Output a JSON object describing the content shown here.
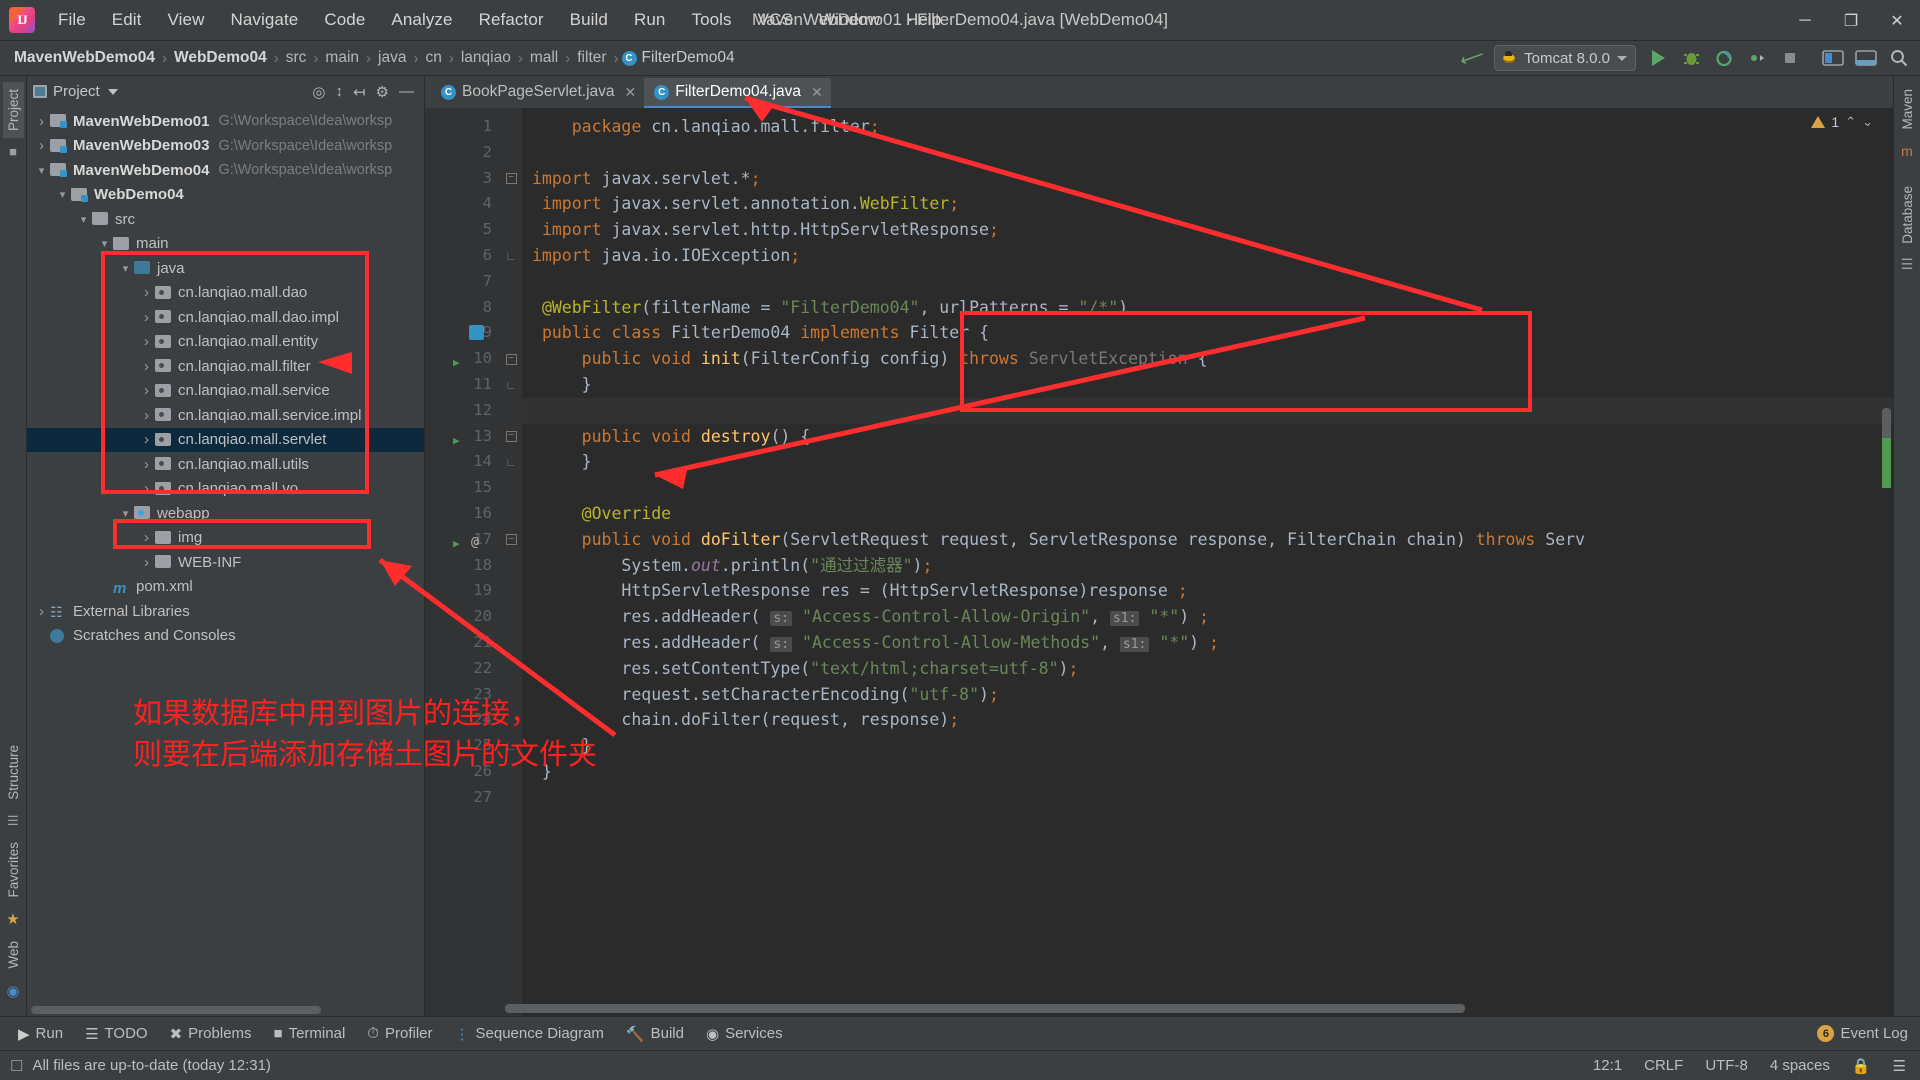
{
  "window": {
    "title": "MavenWebDemo01 - FilterDemo04.java [WebDemo04]",
    "minimize": "─",
    "maximize": "❐",
    "close": "✕"
  },
  "menubar": [
    {
      "label": "File"
    },
    {
      "label": "Edit"
    },
    {
      "label": "View"
    },
    {
      "label": "Navigate"
    },
    {
      "label": "Code"
    },
    {
      "label": "Analyze"
    },
    {
      "label": "Refactor"
    },
    {
      "label": "Build"
    },
    {
      "label": "Run"
    },
    {
      "label": "Tools"
    },
    {
      "label": "VCS"
    },
    {
      "label": "Window"
    },
    {
      "label": "Help"
    }
  ],
  "breadcrumb": {
    "items": [
      "MavenWebDemo04",
      "WebDemo04",
      "src",
      "main",
      "java",
      "cn",
      "lanqiao",
      "mall",
      "filter"
    ],
    "file": "FilterDemo04",
    "file_icon": "C",
    "separator": "›"
  },
  "toolbar": {
    "build_icon": "hammer-icon",
    "run_config": "Tomcat 8.0.0",
    "run_label": "run-icon",
    "debug_label": "debug-icon",
    "run_coverage_label": "run-with-coverage-icon",
    "more_label": "more-icon",
    "stop_label": "stop-icon",
    "layout_label": "layout-icon",
    "settings_label": "settings-icon",
    "search_label": "search-icon"
  },
  "left_strip": {
    "project_tab": "Project",
    "structure_tab": "Structure",
    "favorites_tab": "Favorites",
    "web_tab": "Web"
  },
  "right_strip": {
    "maven_tab": "Maven",
    "database_tab": "Database"
  },
  "project_panel": {
    "title": "Project",
    "actions": [
      "locate-icon",
      "expand-all-icon",
      "collapse-all-icon",
      "settings-icon",
      "hide-icon"
    ],
    "tree": [
      {
        "depth": 0,
        "arrow": "closed",
        "icon": "module",
        "label": "MavenWebDemo01",
        "bold": true,
        "path": "G:\\Workspace\\Idea\\worksp",
        "selected": false
      },
      {
        "depth": 0,
        "arrow": "closed",
        "icon": "module",
        "label": "MavenWebDemo03",
        "bold": true,
        "path": "G:\\Workspace\\Idea\\worksp",
        "selected": false
      },
      {
        "depth": 0,
        "arrow": "open",
        "icon": "module",
        "label": "MavenWebDemo04",
        "bold": true,
        "path": "G:\\Workspace\\Idea\\worksp",
        "selected": false
      },
      {
        "depth": 1,
        "arrow": "open",
        "icon": "module",
        "label": "WebDemo04",
        "bold": true,
        "path": "",
        "selected": false
      },
      {
        "depth": 2,
        "arrow": "open",
        "icon": "folder",
        "label": "src",
        "bold": false,
        "path": "",
        "selected": false
      },
      {
        "depth": 3,
        "arrow": "open",
        "icon": "folder",
        "label": "main",
        "bold": false,
        "path": "",
        "selected": false
      },
      {
        "depth": 4,
        "arrow": "open",
        "icon": "source",
        "label": "java",
        "bold": false,
        "path": "",
        "selected": false
      },
      {
        "depth": 5,
        "arrow": "closed",
        "icon": "package",
        "label": "cn.lanqiao.mall.dao",
        "bold": false,
        "path": "",
        "selected": false
      },
      {
        "depth": 5,
        "arrow": "closed",
        "icon": "package",
        "label": "cn.lanqiao.mall.dao.impl",
        "bold": false,
        "path": "",
        "selected": false
      },
      {
        "depth": 5,
        "arrow": "closed",
        "icon": "package",
        "label": "cn.lanqiao.mall.entity",
        "bold": false,
        "path": "",
        "selected": false
      },
      {
        "depth": 5,
        "arrow": "closed",
        "icon": "package",
        "label": "cn.lanqiao.mall.filter",
        "bold": false,
        "path": "",
        "selected": false
      },
      {
        "depth": 5,
        "arrow": "closed",
        "icon": "package",
        "label": "cn.lanqiao.mall.service",
        "bold": false,
        "path": "",
        "selected": false
      },
      {
        "depth": 5,
        "arrow": "closed",
        "icon": "package",
        "label": "cn.lanqiao.mall.service.impl",
        "bold": false,
        "path": "",
        "selected": false
      },
      {
        "depth": 5,
        "arrow": "closed",
        "icon": "package",
        "label": "cn.lanqiao.mall.servlet",
        "bold": false,
        "path": "",
        "selected": true
      },
      {
        "depth": 5,
        "arrow": "closed",
        "icon": "package",
        "label": "cn.lanqiao.mall.utils",
        "bold": false,
        "path": "",
        "selected": false
      },
      {
        "depth": 5,
        "arrow": "closed",
        "icon": "package",
        "label": "cn.lanqiao.mall.vo",
        "bold": false,
        "path": "",
        "selected": false
      },
      {
        "depth": 4,
        "arrow": "open",
        "icon": "webapp",
        "label": "webapp",
        "bold": false,
        "path": "",
        "selected": false
      },
      {
        "depth": 5,
        "arrow": "closed",
        "icon": "folder",
        "label": "img",
        "bold": false,
        "path": "",
        "selected": false
      },
      {
        "depth": 5,
        "arrow": "closed",
        "icon": "folder",
        "label": "WEB-INF",
        "bold": false,
        "path": "",
        "selected": false
      },
      {
        "depth": 3,
        "arrow": "none",
        "icon": "maven",
        "label": "pom.xml",
        "bold": false,
        "path": "",
        "selected": false
      },
      {
        "depth": 0,
        "arrow": "closed",
        "icon": "library",
        "label": "External Libraries",
        "bold": false,
        "path": "",
        "selected": false
      },
      {
        "depth": 0,
        "arrow": "none",
        "icon": "scratch",
        "label": "Scratches and Consoles",
        "bold": false,
        "path": "",
        "selected": false
      }
    ]
  },
  "editor": {
    "tabs": [
      {
        "label": "BookPageServlet.java",
        "icon": "C",
        "active": false,
        "close": "✕"
      },
      {
        "label": "FilterDemo04.java",
        "icon": "C",
        "active": true,
        "close": "✕"
      }
    ],
    "warning_count": "1",
    "warning_icon": "warning-triangle-icon",
    "chevron_up": "⌃",
    "chevron_down": "⌄",
    "lines": [
      {
        "n": "1",
        "marks": [],
        "fold": "",
        "html": "    <span class='kw'>package</span> cn.lanqiao.mall.filter<span class='kw'>;</span>"
      },
      {
        "n": "2",
        "marks": [],
        "fold": "",
        "html": ""
      },
      {
        "n": "3",
        "marks": [],
        "fold": "f",
        "html": "<span class='kw'>import</span> javax.servlet.*<span class='kw'>;</span>"
      },
      {
        "n": "4",
        "marks": [],
        "fold": "",
        "html": " <span class='kw'>import</span> javax.servlet.annotation.<span class='ann'>WebFilter</span><span class='kw'>;</span>"
      },
      {
        "n": "5",
        "marks": [],
        "fold": "",
        "html": " <span class='kw'>import</span> javax.servlet.http.HttpServletResponse<span class='kw'>;</span>"
      },
      {
        "n": "6",
        "marks": [],
        "fold": "u",
        "html": "<span class='kw'>import</span> java.io.IOException<span class='kw'>;</span>"
      },
      {
        "n": "7",
        "marks": [],
        "fold": "",
        "html": ""
      },
      {
        "n": "8",
        "marks": [],
        "fold": "",
        "html": " <span class='ann'>@WebFilter</span>(filterName = <span class='str'>\"FilterDemo04\"</span>, urlPatterns = <span class='str'>\"/*\"</span>)"
      },
      {
        "n": "9",
        "marks": [
          "impl"
        ],
        "fold": "",
        "html": " <span class='kw'>public class</span> <span style='color:#a9b7c6'>FilterDemo04</span> <span class='kw'>implements</span> Filter {"
      },
      {
        "n": "10",
        "marks": [
          "run"
        ],
        "fold": "f",
        "html": "     <span class='kw'>public void</span> <span class='fn'>init</span>(FilterConfig config) <span class='kw'>throws</span> <span class='grey'>ServletException</span> {"
      },
      {
        "n": "11",
        "marks": [],
        "fold": "u",
        "html": "     }"
      },
      {
        "n": "12",
        "marks": [],
        "fold": "",
        "html": "",
        "hl": true
      },
      {
        "n": "13",
        "marks": [
          "run"
        ],
        "fold": "f",
        "html": "     <span class='kw'>public void</span> <span class='fn'>destroy</span>() {"
      },
      {
        "n": "14",
        "marks": [],
        "fold": "u",
        "html": "     }"
      },
      {
        "n": "15",
        "marks": [],
        "fold": "",
        "html": ""
      },
      {
        "n": "16",
        "marks": [],
        "fold": "",
        "html": "     <span class='ann'>@Override</span>"
      },
      {
        "n": "17",
        "marks": [
          "run",
          "at"
        ],
        "fold": "f",
        "html": "     <span class='kw'>public void</span> <span class='fn'>doFilter</span>(ServletRequest request, ServletResponse response, FilterChain chain) <span class='kw'>throws</span> Serv"
      },
      {
        "n": "18",
        "marks": [],
        "fold": "",
        "html": "         System.<span class='fld'>out</span>.println(<span class='str'>\"通过过滤器\"</span>)<span class='kw'>;</span>"
      },
      {
        "n": "19",
        "marks": [],
        "fold": "",
        "html": "         HttpServletResponse res = (HttpServletResponse)response <span class='kw'>;</span>"
      },
      {
        "n": "20",
        "marks": [],
        "fold": "",
        "html": "         res.addHeader( <span class='hint'>s:</span> <span class='str'>\"Access-Control-Allow-Origin\"</span>, <span class='hint'>s1:</span> <span class='str'>\"*\"</span>) <span class='kw'>;</span>"
      },
      {
        "n": "21",
        "marks": [],
        "fold": "",
        "html": "         res.addHeader( <span class='hint'>s:</span> <span class='str'>\"Access-Control-Allow-Methods\"</span>, <span class='hint'>s1:</span> <span class='str'>\"*\"</span>) <span class='kw'>;</span>"
      },
      {
        "n": "22",
        "marks": [],
        "fold": "",
        "html": "         res.setContentType(<span class='str'>\"text/html;charset=utf-8\"</span>)<span class='kw'>;</span>"
      },
      {
        "n": "23",
        "marks": [],
        "fold": "",
        "html": "         request.setCharacterEncoding(<span class='str'>\"utf-8\"</span>)<span class='kw'>;</span>"
      },
      {
        "n": "24",
        "marks": [],
        "fold": "",
        "html": "         chain.doFilter(request, response)<span class='kw'>;</span>"
      },
      {
        "n": "25",
        "marks": [],
        "fold": "u",
        "html": "     }"
      },
      {
        "n": "26",
        "marks": [],
        "fold": "",
        "html": " }"
      },
      {
        "n": "27",
        "marks": [],
        "fold": "",
        "html": ""
      }
    ]
  },
  "tool_window_bar": {
    "items": [
      {
        "label": "Run",
        "icon": "run-icon"
      },
      {
        "label": "TODO",
        "icon": "todo-icon"
      },
      {
        "label": "Problems",
        "icon": "problems-icon"
      },
      {
        "label": "Terminal",
        "icon": "terminal-icon"
      },
      {
        "label": "Profiler",
        "icon": "profiler-icon"
      },
      {
        "label": "Sequence Diagram",
        "icon": "sequence-diagram-icon"
      },
      {
        "label": "Build",
        "icon": "build-icon"
      },
      {
        "label": "Services",
        "icon": "services-icon"
      }
    ],
    "event_log": "Event Log",
    "event_log_badge": "6"
  },
  "status_bar": {
    "message": "All files are up-to-date (today 12:31)",
    "caret": "12:1",
    "line_sep": "CRLF",
    "encoding": "UTF-8",
    "indent": "4 spaces",
    "lock_icon": "lock-icon"
  },
  "annotations": {
    "note_line1": "如果数据库中用到图片的连接，",
    "note_line2": "则要在后端添加存储土图片的文件夹",
    "color": "#ff2020"
  }
}
